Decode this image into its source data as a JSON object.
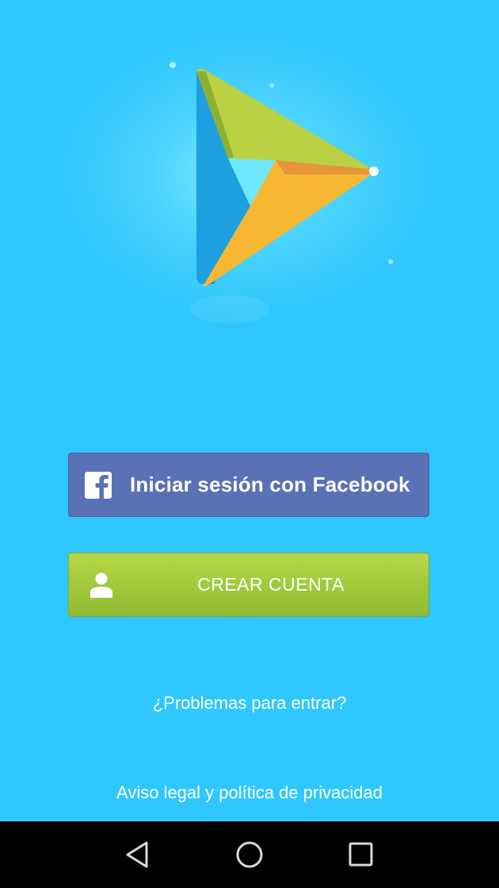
{
  "login": {
    "facebook_button_label": "Iniciar sesión con Facebook",
    "create_account_label": "CREAR CUENTA",
    "trouble_link": "¿Problemas para entrar?",
    "legal_link": "Aviso legal y política de privacidad"
  },
  "icons": {
    "logo": "play-logo-icon",
    "facebook": "facebook-icon",
    "account": "person-icon",
    "nav_back": "back-triangle-icon",
    "nav_home": "home-circle-icon",
    "nav_recent": "recent-square-icon"
  },
  "colors": {
    "background": "#2fc7fc",
    "facebook_button": "#5a71b5",
    "create_button": "#9ec73a",
    "logo_blue": "#1a9ee0",
    "logo_green": "#b8d042",
    "logo_orange": "#f9b531",
    "navbar": "#000000"
  }
}
